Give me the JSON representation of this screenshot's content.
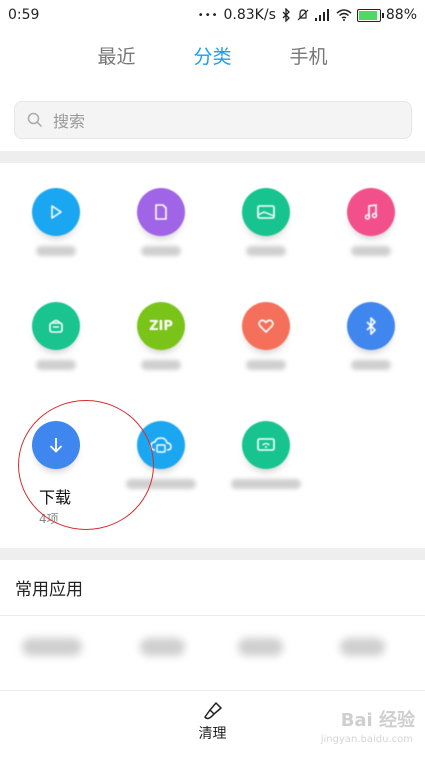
{
  "status_bar": {
    "time": "0:59",
    "net_speed": "0.83K/s",
    "battery_level": "88%"
  },
  "tabs": [
    {
      "label": "最近",
      "active": false
    },
    {
      "label": "分类",
      "active": true
    },
    {
      "label": "手机",
      "active": false
    }
  ],
  "search": {
    "placeholder": "搜索"
  },
  "categories": [
    {
      "icon": "play-icon",
      "color": "#1aa6f0"
    },
    {
      "icon": "document-icon",
      "color": "#a064e6"
    },
    {
      "icon": "image-icon",
      "color": "#17c48f"
    },
    {
      "icon": "music-icon",
      "color": "#f2508a"
    },
    {
      "icon": "apk-icon",
      "color": "#19c48f"
    },
    {
      "icon": "zip-icon",
      "color": "#7ac41a",
      "text": "ZIP"
    },
    {
      "icon": "heart-icon",
      "color": "#f4705a"
    },
    {
      "icon": "bluetooth-icon",
      "color": "#3f86ee"
    },
    {
      "icon": "download-icon",
      "color": "#3f86ee",
      "title": "下载",
      "count": "4项"
    },
    {
      "icon": "cloud-icon",
      "color": "#1aa6f0"
    },
    {
      "icon": "remote-icon",
      "color": "#17c48f"
    }
  ],
  "common_apps": {
    "title": "常用应用"
  },
  "bottom_bar": {
    "clean_label": "清理"
  },
  "watermark": {
    "text": "Bai 经验",
    "sub": "jingyan.baidu.com"
  }
}
